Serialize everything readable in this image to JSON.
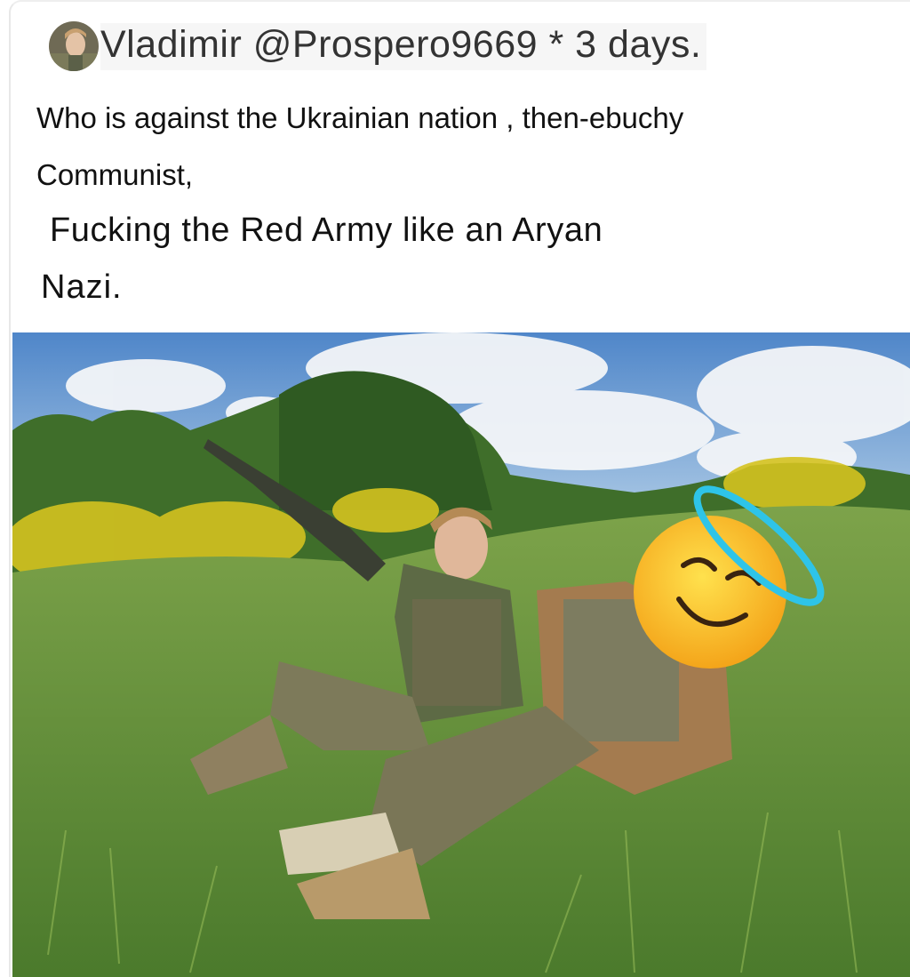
{
  "post": {
    "author_line": "Vladimir @Prospero9669 * 3 days.",
    "text_lines": [
      "Who is against the Ukrainian nation , then-ebuchy",
      "Communist,",
      "Fucking the Red Army like an Aryan",
      "Nazi."
    ]
  },
  "photo": {
    "description_icon": "photo-image",
    "sticker_icon": "smiling-face-with-halo-icon"
  }
}
